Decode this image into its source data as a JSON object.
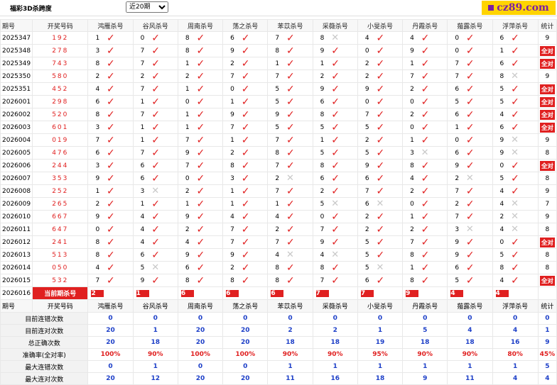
{
  "header": {
    "title": "福彩3D杀跨度",
    "select_value": "近20期",
    "brand": "cz89.com"
  },
  "columns": [
    "期号",
    "开奖号码",
    "鸿雁杀号",
    "谷风杀号",
    "周南杀号",
    "荡之杀号",
    "苯苡杀号",
    "采薇杀号",
    "小旻杀号",
    "丹霞杀号",
    "薤露杀号",
    "浮萍杀号",
    "统计"
  ],
  "rows": [
    {
      "issue": "2025347",
      "prize": "192",
      "kills": [
        "1",
        "0",
        "8",
        "6",
        "7",
        "8",
        "4",
        "4",
        "0",
        "6"
      ],
      "marks": [
        1,
        1,
        1,
        1,
        1,
        0,
        1,
        1,
        1,
        1
      ],
      "stat": "9"
    },
    {
      "issue": "2025348",
      "prize": "278",
      "kills": [
        "3",
        "7",
        "8",
        "9",
        "8",
        "9",
        "0",
        "9",
        "0",
        "1"
      ],
      "marks": [
        1,
        1,
        1,
        1,
        1,
        1,
        1,
        1,
        1,
        1
      ],
      "stat": "全对"
    },
    {
      "issue": "2025349",
      "prize": "743",
      "kills": [
        "8",
        "7",
        "1",
        "2",
        "1",
        "1",
        "2",
        "1",
        "7",
        "6"
      ],
      "marks": [
        1,
        1,
        1,
        1,
        1,
        1,
        1,
        1,
        1,
        1
      ],
      "stat": "全对"
    },
    {
      "issue": "2025350",
      "prize": "580",
      "kills": [
        "2",
        "2",
        "2",
        "7",
        "7",
        "2",
        "2",
        "7",
        "7",
        "8"
      ],
      "marks": [
        1,
        1,
        1,
        1,
        1,
        1,
        1,
        1,
        1,
        0
      ],
      "stat": "9"
    },
    {
      "issue": "2025351",
      "prize": "452",
      "kills": [
        "4",
        "7",
        "1",
        "0",
        "5",
        "9",
        "9",
        "2",
        "6",
        "5"
      ],
      "marks": [
        1,
        1,
        1,
        1,
        1,
        1,
        1,
        1,
        1,
        1
      ],
      "stat": "全对"
    },
    {
      "issue": "2026001",
      "prize": "298",
      "kills": [
        "6",
        "1",
        "0",
        "1",
        "5",
        "6",
        "0",
        "0",
        "5",
        "5"
      ],
      "marks": [
        1,
        1,
        1,
        1,
        1,
        1,
        1,
        1,
        1,
        1
      ],
      "stat": "全对"
    },
    {
      "issue": "2026002",
      "prize": "520",
      "kills": [
        "8",
        "7",
        "1",
        "9",
        "9",
        "8",
        "7",
        "2",
        "6",
        "4"
      ],
      "marks": [
        1,
        1,
        1,
        1,
        1,
        1,
        1,
        1,
        1,
        1
      ],
      "stat": "全对"
    },
    {
      "issue": "2026003",
      "prize": "601",
      "kills": [
        "3",
        "1",
        "1",
        "7",
        "5",
        "5",
        "5",
        "0",
        "1",
        "6"
      ],
      "marks": [
        1,
        1,
        1,
        1,
        1,
        1,
        1,
        1,
        1,
        1
      ],
      "stat": "全对"
    },
    {
      "issue": "2026004",
      "prize": "019",
      "kills": [
        "7",
        "1",
        "7",
        "1",
        "7",
        "1",
        "2",
        "1",
        "0",
        "9"
      ],
      "marks": [
        1,
        1,
        1,
        1,
        1,
        1,
        1,
        1,
        1,
        0
      ],
      "stat": "9"
    },
    {
      "issue": "2026005",
      "prize": "476",
      "kills": [
        "6",
        "7",
        "9",
        "2",
        "8",
        "5",
        "5",
        "3",
        "6",
        "9"
      ],
      "marks": [
        1,
        1,
        1,
        1,
        1,
        1,
        1,
        0,
        1,
        0
      ],
      "stat": "8"
    },
    {
      "issue": "2026006",
      "prize": "244",
      "kills": [
        "3",
        "6",
        "7",
        "8",
        "7",
        "8",
        "9",
        "8",
        "9",
        "0"
      ],
      "marks": [
        1,
        1,
        1,
        1,
        1,
        1,
        1,
        1,
        1,
        1
      ],
      "stat": "全对"
    },
    {
      "issue": "2026007",
      "prize": "353",
      "kills": [
        "9",
        "6",
        "0",
        "3",
        "2",
        "6",
        "6",
        "4",
        "2",
        "5"
      ],
      "marks": [
        1,
        1,
        1,
        1,
        0,
        1,
        1,
        1,
        0,
        1
      ],
      "stat": "8"
    },
    {
      "issue": "2026008",
      "prize": "252",
      "kills": [
        "1",
        "3",
        "2",
        "1",
        "7",
        "2",
        "7",
        "2",
        "7",
        "4"
      ],
      "marks": [
        1,
        0,
        1,
        1,
        1,
        1,
        1,
        1,
        1,
        1
      ],
      "stat": "9"
    },
    {
      "issue": "2026009",
      "prize": "265",
      "kills": [
        "2",
        "1",
        "1",
        "1",
        "1",
        "5",
        "6",
        "0",
        "2",
        "4"
      ],
      "marks": [
        1,
        1,
        1,
        1,
        1,
        0,
        0,
        1,
        1,
        0
      ],
      "stat": "7"
    },
    {
      "issue": "2026010",
      "prize": "667",
      "kills": [
        "9",
        "4",
        "9",
        "4",
        "4",
        "0",
        "2",
        "1",
        "7",
        "2"
      ],
      "marks": [
        1,
        1,
        1,
        1,
        1,
        1,
        1,
        1,
        1,
        0
      ],
      "stat": "9"
    },
    {
      "issue": "2026011",
      "prize": "647",
      "kills": [
        "0",
        "4",
        "2",
        "7",
        "2",
        "7",
        "2",
        "2",
        "3",
        "4"
      ],
      "marks": [
        1,
        1,
        1,
        1,
        1,
        1,
        1,
        1,
        0,
        0
      ],
      "stat": "8"
    },
    {
      "issue": "2026012",
      "prize": "241",
      "kills": [
        "8",
        "4",
        "4",
        "7",
        "7",
        "9",
        "5",
        "7",
        "9",
        "0"
      ],
      "marks": [
        1,
        1,
        1,
        1,
        1,
        1,
        1,
        1,
        1,
        1
      ],
      "stat": "全对"
    },
    {
      "issue": "2026013",
      "prize": "513",
      "kills": [
        "8",
        "6",
        "9",
        "9",
        "4",
        "4",
        "5",
        "8",
        "9",
        "5"
      ],
      "marks": [
        1,
        1,
        1,
        1,
        0,
        0,
        1,
        1,
        1,
        1
      ],
      "stat": "8"
    },
    {
      "issue": "2026014",
      "prize": "050",
      "kills": [
        "4",
        "5",
        "6",
        "2",
        "8",
        "8",
        "5",
        "1",
        "6",
        "8"
      ],
      "marks": [
        1,
        0,
        1,
        1,
        1,
        1,
        0,
        1,
        1,
        1
      ],
      "stat": "8"
    },
    {
      "issue": "2026015",
      "prize": "532",
      "kills": [
        "7",
        "9",
        "8",
        "8",
        "8",
        "7",
        "6",
        "8",
        "5",
        "4"
      ],
      "marks": [
        1,
        1,
        1,
        1,
        1,
        1,
        1,
        1,
        1,
        1
      ],
      "stat": "全对"
    }
  ],
  "current": {
    "issue": "2026016",
    "label": "当前期杀号",
    "kills": [
      "2",
      "1",
      "6",
      "6",
      "6",
      "7",
      "7",
      "9",
      "4",
      "4"
    ]
  },
  "stats": [
    {
      "label": "目前连错次数",
      "values": [
        "0",
        "0",
        "0",
        "0",
        "0",
        "0",
        "0",
        "0",
        "0",
        "0",
        "0"
      ],
      "style": "val"
    },
    {
      "label": "目前连对次数",
      "values": [
        "20",
        "1",
        "20",
        "20",
        "2",
        "2",
        "1",
        "5",
        "4",
        "4",
        "1"
      ],
      "style": "val"
    },
    {
      "label": "总正确次数",
      "values": [
        "20",
        "18",
        "20",
        "20",
        "18",
        "18",
        "19",
        "18",
        "18",
        "16",
        "9"
      ],
      "style": "val"
    },
    {
      "label": "准确率(全对率)",
      "values": [
        "100%",
        "90%",
        "100%",
        "100%",
        "90%",
        "90%",
        "95%",
        "90%",
        "90%",
        "80%",
        "45%"
      ],
      "style": "pct"
    },
    {
      "label": "最大连错次数",
      "values": [
        "0",
        "1",
        "0",
        "0",
        "1",
        "1",
        "1",
        "1",
        "1",
        "1",
        "5"
      ],
      "style": "val"
    },
    {
      "label": "最大连对次数",
      "values": [
        "20",
        "12",
        "20",
        "20",
        "11",
        "16",
        "18",
        "9",
        "11",
        "4",
        "4"
      ],
      "style": "val"
    }
  ],
  "colors": {
    "accent": "#e02020",
    "value": "#1e40c8",
    "brand_bg": "#ffd400",
    "brand_fg": "#7b1fa2"
  }
}
